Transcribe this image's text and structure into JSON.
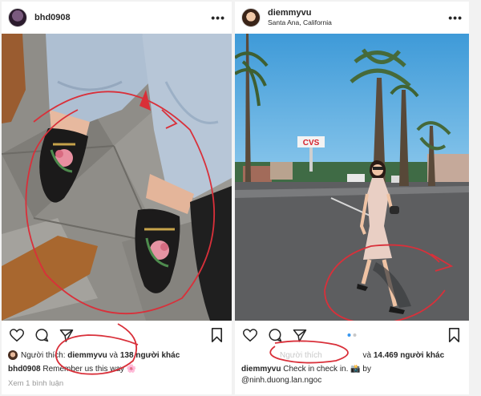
{
  "left_post": {
    "username": "bhd0908",
    "likes": {
      "prefix": "Người thích:",
      "user": "diemmyvu",
      "connector": "và",
      "count_text": "138 người khác"
    },
    "caption": {
      "user": "bhd0908",
      "text": "Remember us this way",
      "emoji": "🌸"
    },
    "comments_link": "Xem 1 bình luận"
  },
  "right_post": {
    "username": "diemmyvu",
    "location": "Santa Ana, California",
    "photo_sign": "CVS",
    "likes": {
      "prefix": "Người thích",
      "connector": "và",
      "count_text": "14.469 người khác"
    },
    "caption": {
      "user": "diemmyvu",
      "text": "Check in check in.",
      "emoji": "📸",
      "by": "by",
      "mention": "@ninh.duong.lan.ngoc"
    },
    "carousel": {
      "slides": 2,
      "active": 1
    }
  },
  "icons": [
    "heart-icon",
    "comment-icon",
    "share-icon",
    "bookmark-icon",
    "more-options-icon"
  ],
  "colors": {
    "annotation_red": "#d9303a",
    "sky": "#4aa3df",
    "asphalt": "#5d5e60",
    "dot_active": "#3897f0"
  }
}
